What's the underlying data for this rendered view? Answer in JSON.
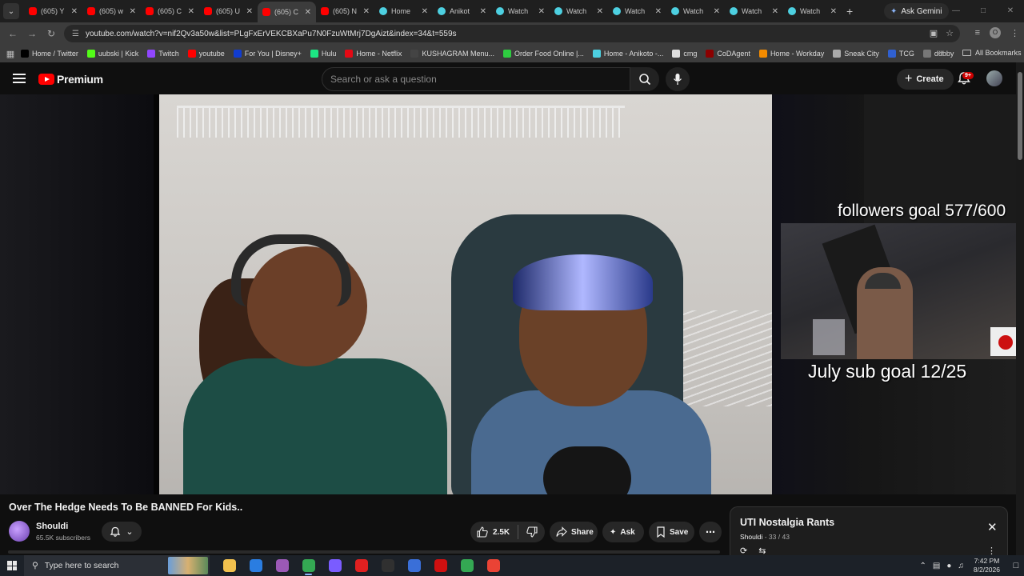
{
  "browser": {
    "tabs": [
      {
        "label": "(605) Y",
        "type": "yt"
      },
      {
        "label": "(605) w",
        "type": "yt"
      },
      {
        "label": "(605) C",
        "type": "yt"
      },
      {
        "label": "(605) U",
        "type": "yt"
      },
      {
        "label": "(605) C",
        "type": "yt",
        "active": true
      },
      {
        "label": "(605) N",
        "type": "yt"
      },
      {
        "label": "Home",
        "type": "ani"
      },
      {
        "label": "Anikot",
        "type": "ani"
      },
      {
        "label": "Watch",
        "type": "ani"
      },
      {
        "label": "Watch",
        "type": "ani"
      },
      {
        "label": "Watch",
        "type": "ani"
      },
      {
        "label": "Watch",
        "type": "ani"
      },
      {
        "label": "Watch",
        "type": "ani"
      },
      {
        "label": "Watch",
        "type": "ani"
      }
    ],
    "new_tab": "+",
    "ask_gemini": "Ask Gemini",
    "url": "youtube.com/watch?v=nif2Qv3a50w&list=PLgFxErVEKCBXaPu7N0FzuWtMrj7DgAizt&index=34&t=559s",
    "profile_initial": "O",
    "bookmarks": [
      {
        "label": "Home / Twitter",
        "color": "#000000"
      },
      {
        "label": "uubski | Kick",
        "color": "#53fc18"
      },
      {
        "label": "Twitch",
        "color": "#9146ff"
      },
      {
        "label": "youtube",
        "color": "#ff0000"
      },
      {
        "label": "For You | Disney+",
        "color": "#113ccf"
      },
      {
        "label": "Hulu",
        "color": "#1ce783"
      },
      {
        "label": "Home - Netflix",
        "color": "#e50914"
      },
      {
        "label": "KUSHAGRAM Menu...",
        "color": "#444444"
      },
      {
        "label": "Order Food Online |...",
        "color": "#2ecc40"
      },
      {
        "label": "Home - Anikoto -...",
        "color": "#4dd0e1"
      },
      {
        "label": "cmg",
        "color": "#dddddd"
      },
      {
        "label": "CoDAgent",
        "color": "#8b0000"
      },
      {
        "label": "Home - Workday",
        "color": "#f38b00"
      },
      {
        "label": "Sneak City",
        "color": "#aaaaaa"
      },
      {
        "label": "TCG",
        "color": "#3060d0"
      },
      {
        "label": "dubby",
        "color": "#777777"
      }
    ],
    "all_bookmarks": "All Bookmarks"
  },
  "youtube": {
    "brand": "Premium",
    "search_placeholder": "Search or ask a question",
    "create_label": "Create",
    "notif_badge": "9+",
    "overlay_followers": "followers goal 577/600",
    "overlay_sub_goal": "July sub goal 12/25",
    "video_title": "Over The Hedge Needs To Be BANNED For Kids..",
    "channel_name": "Shouldi",
    "channel_subs": "65.5K subscribers",
    "like_count": "2.5K",
    "share_label": "Share",
    "ask_label": "Ask",
    "save_label": "Save",
    "playlist": {
      "title": "UTI Nostalgia Rants",
      "owner": "Shouldi",
      "position": "33 / 43"
    }
  },
  "taskbar": {
    "search_placeholder": "Type here to search",
    "apps": [
      {
        "name": "file-explorer",
        "color": "#f2c14e",
        "open": false
      },
      {
        "name": "store-app",
        "color": "#2a7de1",
        "open": false
      },
      {
        "name": "discord-like-app",
        "color": "#9b59b6",
        "open": false
      },
      {
        "name": "chrome-app-1",
        "color": "#34a853",
        "open": true
      },
      {
        "name": "game-controller-app",
        "color": "#7a5cff",
        "open": false
      },
      {
        "name": "media-app",
        "color": "#e02020",
        "open": false
      },
      {
        "name": "obs-app",
        "color": "#303030",
        "open": false
      },
      {
        "name": "blue-app",
        "color": "#3a6fd8",
        "open": false
      },
      {
        "name": "amd-app",
        "color": "#d01010",
        "open": false
      },
      {
        "name": "chrome-app-2",
        "color": "#34a853",
        "open": false
      },
      {
        "name": "chrome-app-3",
        "color": "#ea4335",
        "open": false
      }
    ],
    "time": "7:42 PM",
    "date": "8/2/2026"
  }
}
